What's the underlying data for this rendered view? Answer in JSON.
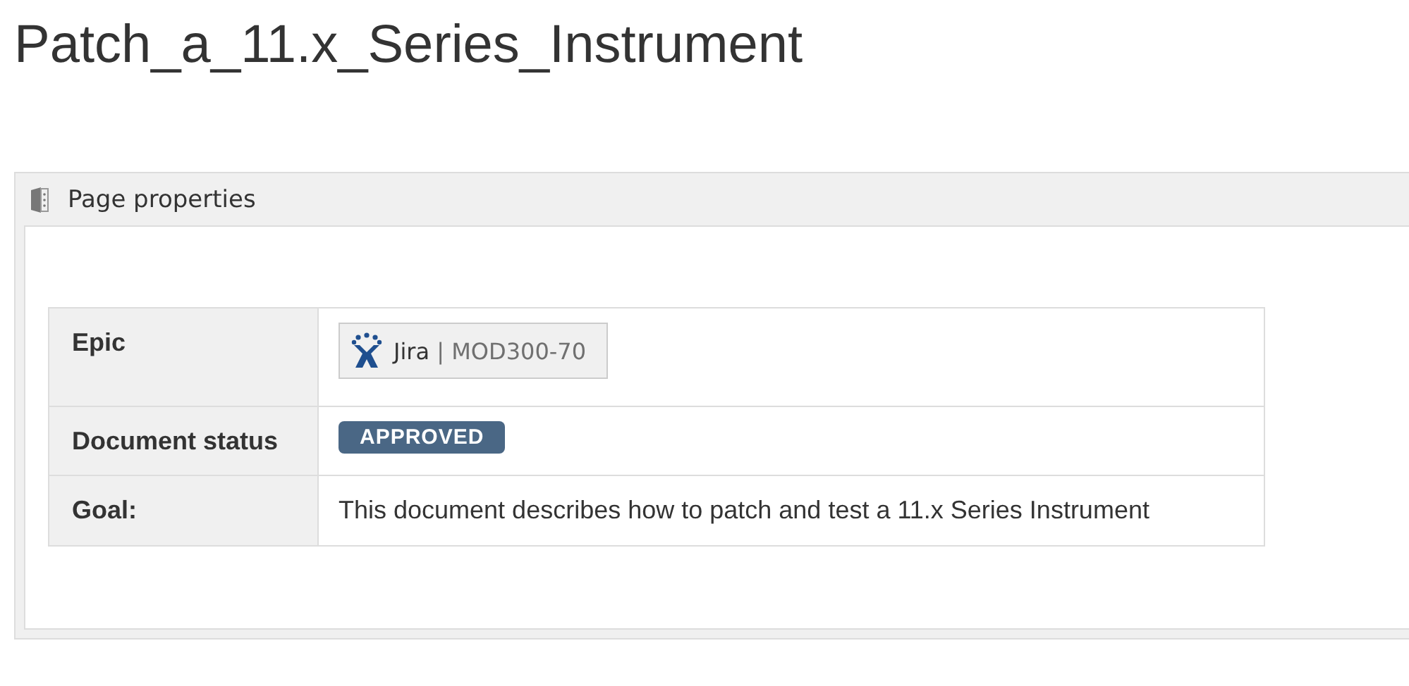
{
  "page_title": "Patch_a_11.x_Series_Instrument",
  "panel": {
    "title": "Page properties",
    "rows": [
      {
        "label": "Epic",
        "kind": "jira",
        "app": "Jira",
        "separator": "|",
        "key": "MOD300-70"
      },
      {
        "label": "Document status",
        "kind": "status",
        "value": "APPROVED"
      },
      {
        "label": "Goal:",
        "kind": "text",
        "value": "This document describes how to patch and test a 11.x Series Instrument"
      }
    ]
  }
}
